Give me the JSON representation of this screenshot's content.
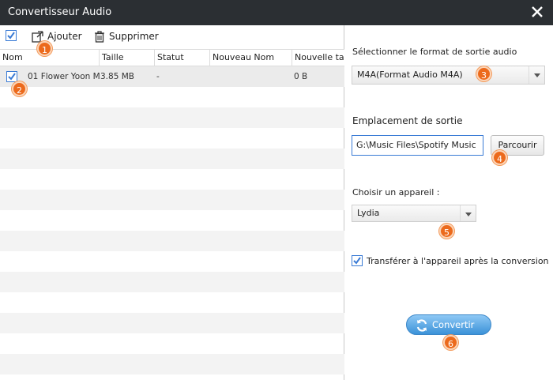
{
  "window": {
    "title": "Convertisseur Audio"
  },
  "toolbar": {
    "add_label": "Ajouter",
    "delete_label": "Supprimer"
  },
  "table": {
    "headers": [
      "Nom",
      "Taille",
      "Statut",
      "Nouveau Nom",
      "Nouvelle taille"
    ],
    "rows": [
      {
        "name": "01 Flower Yoon M...",
        "size": "3.85 MB",
        "status": "-",
        "new_name": "",
        "new_size": "0 B",
        "checked": true
      }
    ]
  },
  "output_format": {
    "label": "Sélectionner le format de sortie audio",
    "selected": "M4A(Format Audio M4A)"
  },
  "output_location": {
    "label": "Emplacement de sortie",
    "path": "G:\\Music Files\\Spotify Music",
    "browse_label": "Parcourir"
  },
  "device": {
    "label": "Choisir un appareil :",
    "selected": "Lydia"
  },
  "transfer": {
    "label": "Transférer à l'appareil après la conversion",
    "checked": true
  },
  "convert": {
    "label": "Convertir"
  },
  "badges": [
    "1",
    "2",
    "3",
    "4",
    "5",
    "6"
  ],
  "colors": {
    "titlebar": "#2b2f33",
    "accent": "#3a7bd5",
    "badge": "#ec6a1c",
    "convert": "#3b92d8"
  }
}
